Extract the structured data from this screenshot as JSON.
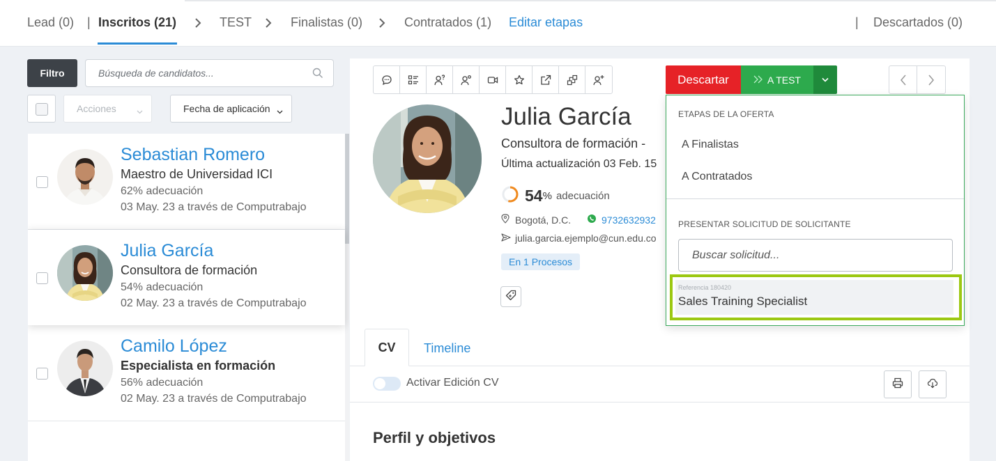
{
  "stages": {
    "lead": "Lead (0)",
    "inscritos": "Inscritos (21)",
    "test": "TEST",
    "finalistas": "Finalistas (0)",
    "contratados": "Contratados (1)",
    "edit": "Editar etapas",
    "descartados": "Descartados (0)"
  },
  "filters": {
    "filter_label": "Filtro",
    "search_placeholder": "Búsqueda de candidatos...",
    "actions_label": "Acciones",
    "sort_label": "Fecha de aplicación"
  },
  "candidates": [
    {
      "name": "Sebastian Romero",
      "role": "Maestro de Universidad ICI",
      "fit": "62% adecuación",
      "date": "03 May. 23 a través de Computrabajo"
    },
    {
      "name": "Julia García",
      "role": "Consultora de formación",
      "fit": "54% adecuación",
      "date": "02 May. 23 a través de Computrabajo"
    },
    {
      "name": "Camilo López",
      "role": "Especialista en formación",
      "fit": "56% adecuación",
      "date": "02 May. 23 a través de Computrabajo"
    }
  ],
  "detail": {
    "name": "Julia García",
    "role": "Consultora de formación -",
    "updated": "Última actualización 03 Feb. 15",
    "fit_value": "54",
    "fit_percent": 54,
    "fit_unit": "%",
    "fit_label": "adecuación",
    "location": "Bogotá, D.C.",
    "phone": "9732632932",
    "email": "julia.garcia.ejemplo@cun.edu.co",
    "processes": "En 1 Procesos"
  },
  "actions": {
    "discard": "Descartar",
    "advance": "A TEST"
  },
  "toolbar_icons": [
    "chat-icon",
    "checklist-icon",
    "user-question-icon",
    "users-icon",
    "video-icon",
    "star-icon",
    "external-link-icon",
    "transfer-icon",
    "user-add-icon"
  ],
  "tabs": {
    "cv": "CV",
    "timeline": "Timeline"
  },
  "cv": {
    "edit_toggle_label": "Activar Edición CV",
    "section_title": "Perfil y objetivos"
  },
  "dropdown": {
    "stages_header": "ETAPAS DE LA OFERTA",
    "stage_items": [
      "A Finalistas",
      "A Contratados"
    ],
    "apply_header": "PRESENTAR SOLICITUD DE SOLICITANTE",
    "search_placeholder": "Buscar solicitud...",
    "result_ref": "Referencia 180420",
    "result_title": "Sales Training Specialist"
  },
  "colors": {
    "accent": "#2a8bd6",
    "discard": "#e62227",
    "advance": "#2daa4d",
    "highlight": "#9cc812"
  }
}
